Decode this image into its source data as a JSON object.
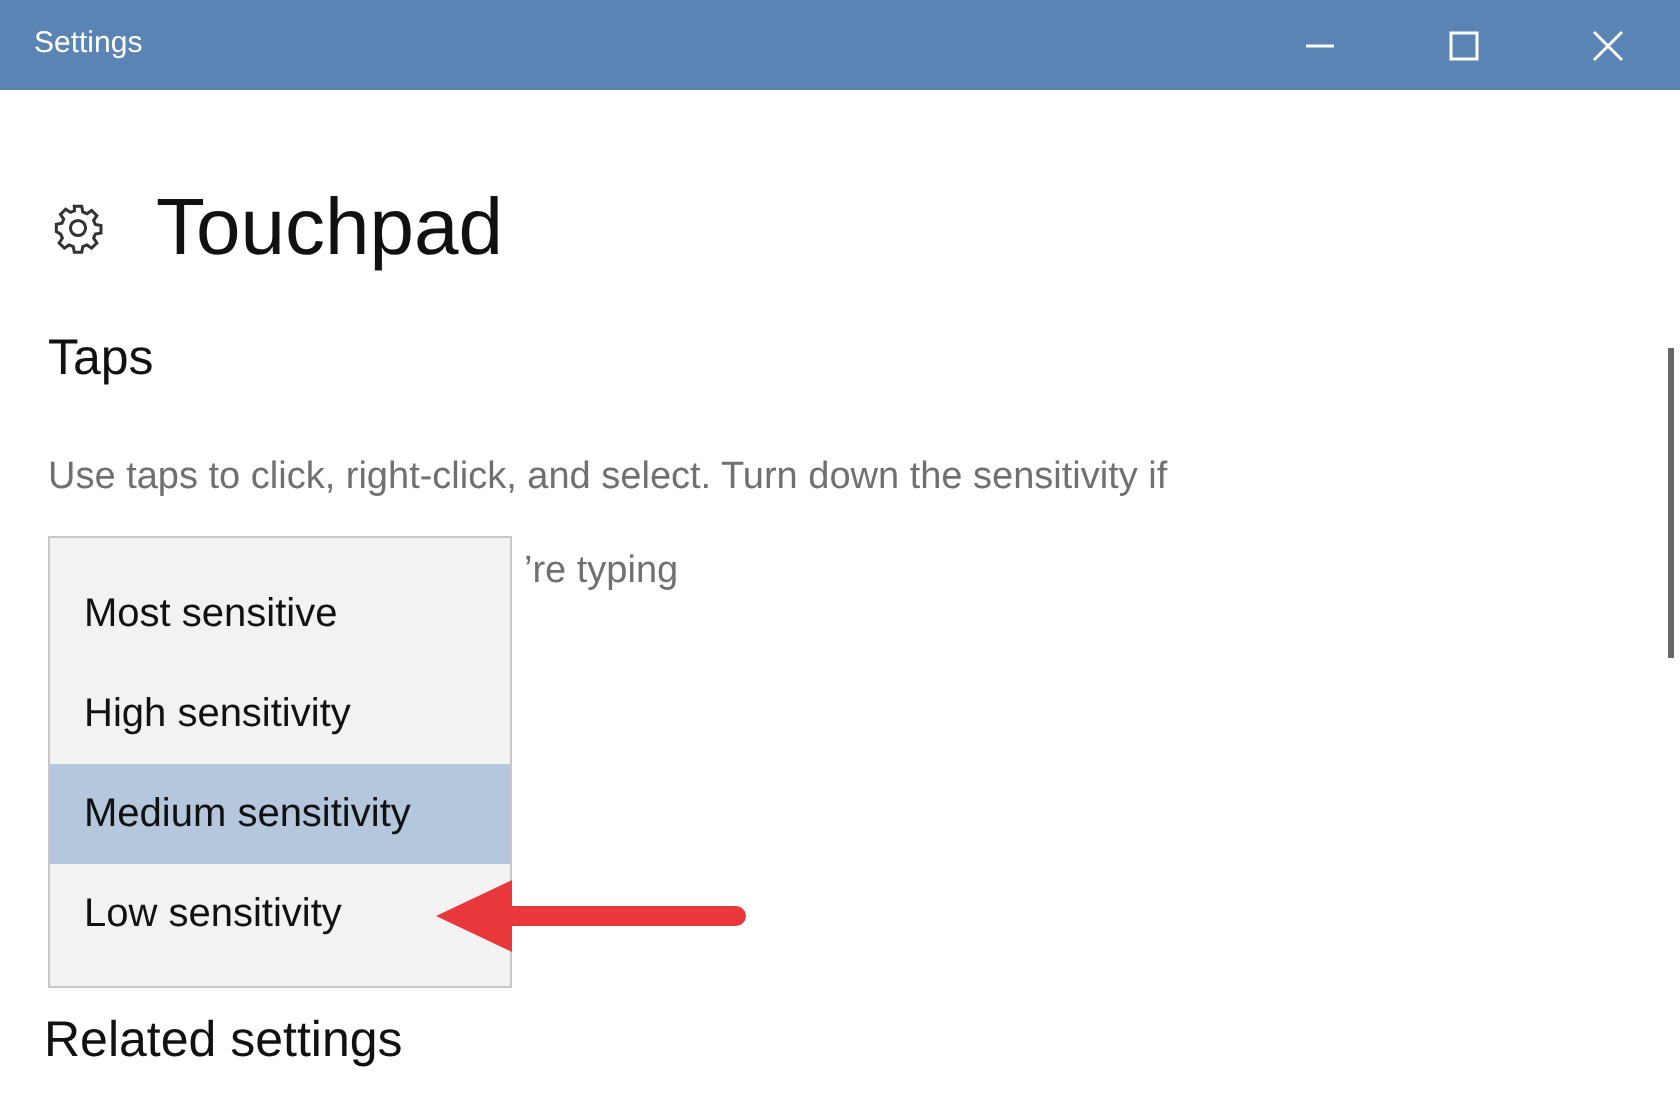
{
  "window": {
    "title": "Settings"
  },
  "page": {
    "title": "Touchpad"
  },
  "section": {
    "title": "Taps",
    "description_line_1": "Use taps to click, right-click, and select. Turn down the sensitivity if",
    "description_line_2_visible": "’re typing"
  },
  "dropdown": {
    "options": [
      {
        "label": "Most sensitive",
        "selected": false
      },
      {
        "label": "High sensitivity",
        "selected": false
      },
      {
        "label": "Medium sensitivity",
        "selected": true
      },
      {
        "label": "Low sensitivity",
        "selected": false
      }
    ]
  },
  "related": {
    "title": "Related settings"
  }
}
